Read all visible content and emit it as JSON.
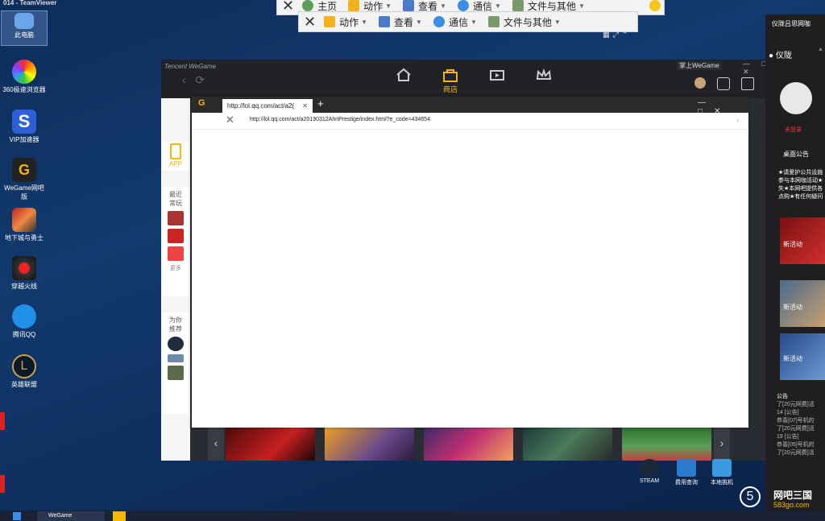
{
  "teamviewer": {
    "title": "014 - TeamViewer"
  },
  "toolbar": {
    "items": [
      {
        "label": "主页",
        "icon": "home-icon",
        "has_caret": false
      },
      {
        "label": "动作",
        "icon": "lightning-icon",
        "has_caret": true
      },
      {
        "label": "查看",
        "icon": "view-icon",
        "has_caret": true
      },
      {
        "label": "通信",
        "icon": "phone-icon",
        "has_caret": true
      },
      {
        "label": "文件与其他",
        "icon": "file-icon",
        "has_caret": true
      }
    ]
  },
  "toolbar2": {
    "items": [
      {
        "label": "动作",
        "icon": "lightning-icon"
      },
      {
        "label": "查看",
        "icon": "view-icon"
      },
      {
        "label": "通信",
        "icon": "phone-icon"
      },
      {
        "label": "文件与其他",
        "icon": "file-icon"
      }
    ]
  },
  "desktop_icons": [
    {
      "label": "此电脑",
      "icon": "computer-icon",
      "selected": true
    },
    {
      "label": "360极速浏览器",
      "icon": "browser-360-icon"
    },
    {
      "label": "VIP加速器",
      "icon": "vip-accelerator-icon"
    },
    {
      "label": "WeGame网吧版",
      "icon": "wegame-icon"
    },
    {
      "label": "地下城与勇士",
      "icon": "dnf-icon"
    },
    {
      "label": "穿越火线",
      "icon": "crossfire-icon"
    },
    {
      "label": "腾讯QQ",
      "icon": "qq-icon"
    },
    {
      "label": "英雄联盟",
      "icon": "lol-icon"
    }
  ],
  "wegame": {
    "logo": "Tencent WeGame",
    "onweb": "掌上WeGame",
    "nav": [
      {
        "label": "",
        "icon": "home-icon"
      },
      {
        "label": "商店",
        "icon": "store-bag-icon",
        "active": true
      },
      {
        "label": "",
        "icon": "video-icon"
      },
      {
        "label": "",
        "icon": "crown-icon"
      }
    ],
    "sidebar": {
      "app_label": "APP",
      "recent_label": "最近常玩",
      "more_label": "更多",
      "recommend_label": "为你推荐"
    }
  },
  "browser": {
    "tab_title": "http://lol.qq.com/act/a2(",
    "url": "http://lol.qq.com/act/a20190312AhriPrestige/index.html?e_code=434654"
  },
  "right_panel": {
    "title": "仪陇吕思网咖",
    "location": "仪陇",
    "unlogged": "未登录",
    "notice_header": "桌面公告",
    "notice_text": "★请爱护公共设施参与本网咖活动★失★本网吧提供各点购★有任何疑问",
    "banners": [
      "新活动",
      "新活动",
      "新活动"
    ],
    "news_header": "公告",
    "news": [
      "了[20元网费]活",
      "14 [公告]",
      "恭喜[07]号机的",
      "了[20元网费]活",
      "19 [公告]",
      "恭喜[05]号机的",
      "了[20元网费]活"
    ]
  },
  "bottom_icons": [
    {
      "label": "STEAM",
      "icon": "steam-icon"
    },
    {
      "label": "费用查询",
      "icon": "fee-query-icon"
    },
    {
      "label": "本地挑机",
      "icon": "local-pc-icon"
    }
  ],
  "brand": {
    "name": "网吧三国",
    "domain": "583go.com",
    "number": "5"
  },
  "taskbar": {
    "app": "WeGame"
  },
  "colors": {
    "wegame_gold": "#f5b800",
    "desktop_blue": "#123a6e",
    "notice_red": "#e33333"
  }
}
